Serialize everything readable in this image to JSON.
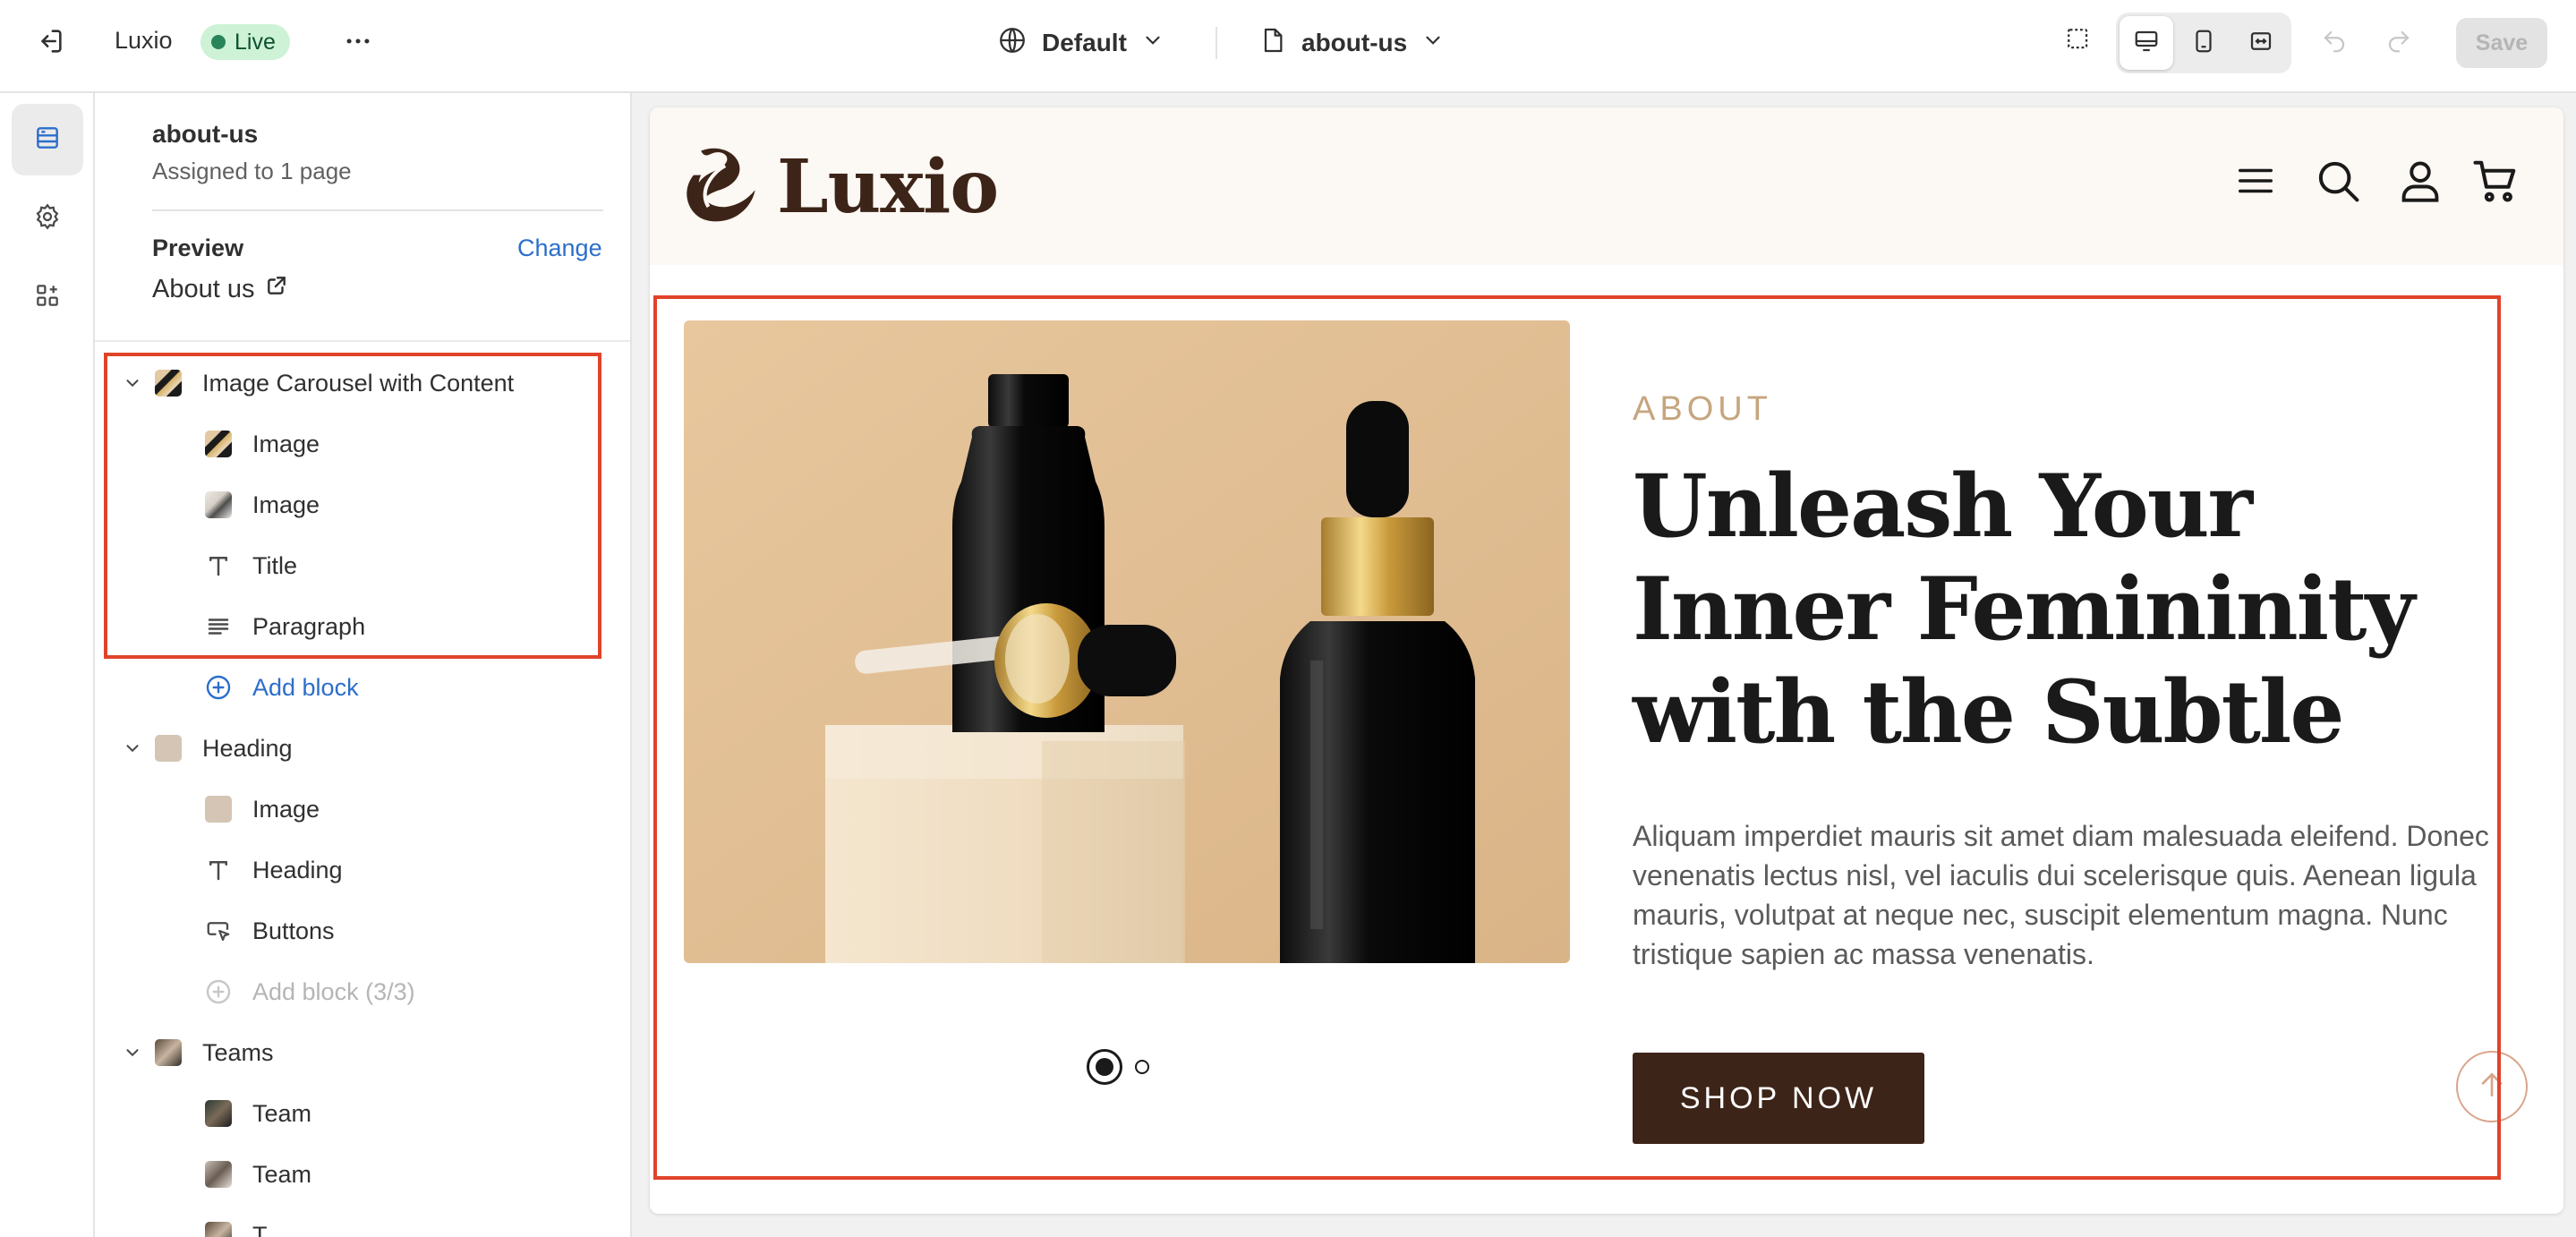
{
  "topbar": {
    "store_name": "Luxio",
    "status_badge": "Live",
    "theme_selector": "Default",
    "page_selector": "about-us",
    "save_label": "Save"
  },
  "sidebar": {
    "template_name": "about-us",
    "assigned": "Assigned to 1 page",
    "preview_label": "Preview",
    "change_label": "Change",
    "preview_page": "About us",
    "sections": [
      {
        "label": "Image Carousel with Content",
        "blocks": [
          {
            "label": "Image",
            "icon": "image-thumb"
          },
          {
            "label": "Image",
            "icon": "image-thumb"
          },
          {
            "label": "Title",
            "icon": "text-icon"
          },
          {
            "label": "Paragraph",
            "icon": "paragraph-icon"
          }
        ],
        "add_block": "Add block"
      },
      {
        "label": "Heading",
        "blocks": [
          {
            "label": "Image",
            "icon": "image-thumb"
          },
          {
            "label": "Heading",
            "icon": "text-icon"
          },
          {
            "label": "Buttons",
            "icon": "button-icon"
          }
        ],
        "add_block": "Add block (3/3)"
      },
      {
        "label": "Teams",
        "blocks": [
          {
            "label": "Team",
            "icon": "image-thumb"
          },
          {
            "label": "Team",
            "icon": "image-thumb"
          },
          {
            "label": "T",
            "icon": "image-thumb"
          }
        ]
      }
    ]
  },
  "preview": {
    "logo_text": "Luxio",
    "eyebrow": "ABOUT",
    "title": "Unleash Your Inner Femininity with the Subtle",
    "paragraph": "Aliquam imperdiet mauris sit amet diam malesuada eleifend. Donec venenatis lectus nisl, vel iaculis dui scelerisque quis. Aenean ligula mauris, volutpat at neque nec, suscipit elementum magna. Nunc tristique sapien ac massa venenatis.",
    "cta": "SHOP NOW",
    "carousel_slides": 2,
    "carousel_active": 1
  },
  "colors": {
    "accent_blue": "#2c6ecb",
    "selection_red": "#e0432a",
    "brand_brown": "#3d2418",
    "eyebrow_gold": "#c6a57e",
    "live_green": "#29845a"
  }
}
